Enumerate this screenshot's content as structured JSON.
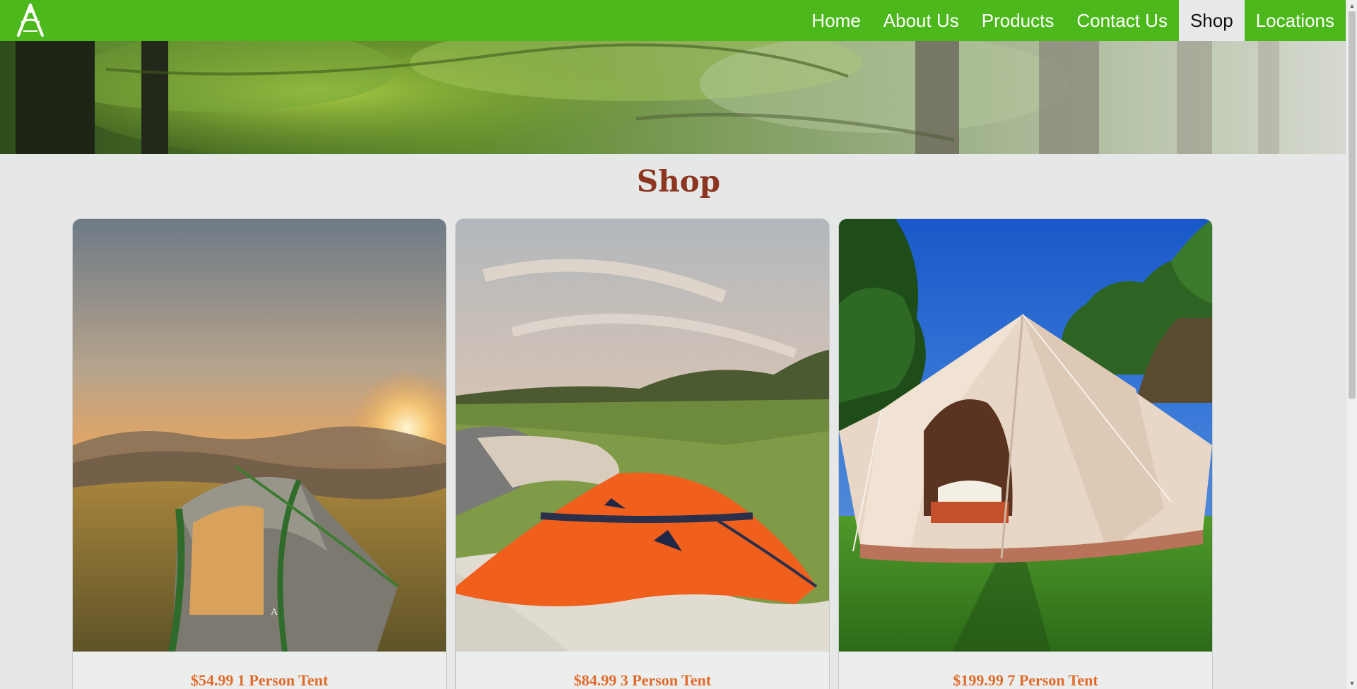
{
  "colors": {
    "nav_bg": "#4cb81b",
    "active_nav_bg": "#e9e9e9",
    "title": "#8c3521",
    "price": "#e06a2a",
    "page_bg": "#e6e8e7"
  },
  "nav": {
    "logo_icon": "acadia-park-logo-icon",
    "items": [
      {
        "label": "Home"
      },
      {
        "label": "About Us"
      },
      {
        "label": "Products"
      },
      {
        "label": "Contact Us"
      },
      {
        "label": "Shop",
        "active": true
      },
      {
        "label": "Locations"
      }
    ]
  },
  "hero": {
    "image": "forest-canopy-banner"
  },
  "page": {
    "title": "Shop"
  },
  "products": [
    {
      "price": "$54.99",
      "name": "1 Person Tent",
      "image": "sunset-hillside-dome-tent"
    },
    {
      "price": "$84.99",
      "name": "3 Person Tent",
      "image": "orange-tent-on-beach"
    },
    {
      "price": "$199.99",
      "name": "7 Person Tent",
      "image": "bell-tent-in-jungle"
    }
  ]
}
